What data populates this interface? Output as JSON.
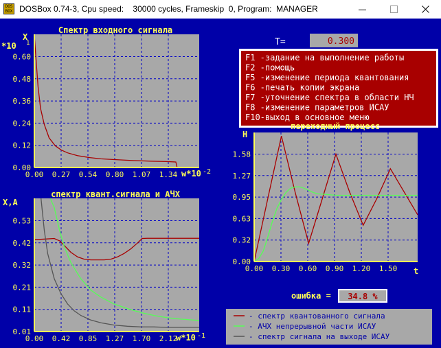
{
  "window": {
    "title": "DOSBox 0.74-3, Cpu speed:    30000 cycles, Frameskip  0, Program:  MANAGER",
    "icon_label": "DOS BOX"
  },
  "colors": {
    "background": "#0000a8",
    "plot_bg": "#a8a8a8",
    "title_yellow": "#ffff55",
    "grid_blue": "#0000c8",
    "series_red": "#a80000",
    "series_green": "#55ff55",
    "series_gray": "#555555",
    "menu_bg": "#a80000"
  },
  "period": {
    "label": "T=",
    "value": "0.300"
  },
  "menu": {
    "items": [
      {
        "key": "F1",
        "text": " -задание на выполнение работы"
      },
      {
        "key": "F2",
        "text": " -помощь"
      },
      {
        "key": "F5",
        "text": " -изменение периода квантования"
      },
      {
        "key": "F6",
        "text": " -печать копии экрана"
      },
      {
        "key": "F7",
        "text": " -уточнение спектра в области НЧ"
      },
      {
        "key": "F8",
        "text": " -изменение параметров ИСАУ"
      },
      {
        "key": "F10",
        "text": "-выход в основное меню"
      }
    ]
  },
  "error": {
    "label": "ошибка =",
    "value": "34.8 %"
  },
  "legend": [
    {
      "text": "- спектр квантованного сигнала",
      "color": "#a80000"
    },
    {
      "text": "- АЧХ непрерывной части ИСАУ",
      "color": "#55ff55"
    },
    {
      "text": "- спектр сигнала на выходе ИСАУ",
      "color": "#555555"
    }
  ],
  "chart_data": [
    {
      "type": "line",
      "title": "Спектр входного сигнала",
      "ylabel": "X",
      "yscale_label": "*10",
      "yscale_exp": "1",
      "xunit_label": "w*10",
      "xunit_exp": "-2",
      "yticks": [
        "0.60",
        "0.48",
        "0.36",
        "0.24",
        "0.12",
        "0.00"
      ],
      "xticks": [
        "0.00",
        "0.27",
        "0.54",
        "0.80",
        "1.07",
        "1.34"
      ],
      "xlim": [
        0,
        1.34
      ],
      "ylim": [
        0,
        0.675
      ],
      "series": [
        {
          "color": "#a80000",
          "x": [
            0.0,
            0.01,
            0.03,
            0.05,
            0.08,
            0.12,
            0.17,
            0.22,
            0.27,
            0.35,
            0.45,
            0.54,
            0.65,
            0.8,
            0.95,
            1.07,
            1.15,
            1.16,
            1.25,
            1.34
          ],
          "y": [
            0.67,
            0.58,
            0.41,
            0.3,
            0.22,
            0.15,
            0.11,
            0.088,
            0.074,
            0.06,
            0.05,
            0.044,
            0.04,
            0.035,
            0.032,
            0.03,
            0.028,
            0.0,
            0.0,
            0.0
          ]
        }
      ]
    },
    {
      "type": "line",
      "title": "спектр квант.сигнала и АЧХ",
      "ylabel": "X,A",
      "xunit_label": "w*10",
      "xunit_exp": "-1",
      "yticks": [
        "0.53",
        "0.42",
        "0.32",
        "0.21",
        "0.11",
        "0.01"
      ],
      "xticks": [
        "0.00",
        "0.42",
        "0.85",
        "1.27",
        "1.70",
        "2.12"
      ],
      "xlim": [
        0,
        2.48
      ],
      "ylim": [
        0.01,
        0.59
      ],
      "series": [
        {
          "color": "#a80000",
          "x": [
            0.0,
            0.3,
            0.38,
            0.45,
            0.55,
            0.65,
            0.75,
            0.85,
            0.95,
            1.05,
            1.15,
            1.25,
            1.35,
            1.45,
            1.55,
            1.62,
            1.7,
            1.8,
            2.0,
            2.2,
            2.48
          ],
          "y": [
            0.41,
            0.415,
            0.405,
            0.385,
            0.355,
            0.335,
            0.325,
            0.322,
            0.322,
            0.322,
            0.325,
            0.335,
            0.35,
            0.37,
            0.395,
            0.415,
            0.416,
            0.416,
            0.416,
            0.416,
            0.416
          ]
        },
        {
          "color": "#55ff55",
          "x": [
            0.24,
            0.3,
            0.38,
            0.45,
            0.55,
            0.7,
            0.85,
            1.0,
            1.2,
            1.4,
            1.6,
            1.8,
            2.0,
            2.2,
            2.48
          ],
          "y": [
            0.59,
            0.55,
            0.45,
            0.38,
            0.31,
            0.24,
            0.19,
            0.16,
            0.13,
            0.11,
            0.093,
            0.08,
            0.07,
            0.064,
            0.058
          ]
        },
        {
          "color": "#555555",
          "x": [
            0.1,
            0.15,
            0.2,
            0.3,
            0.4,
            0.5,
            0.6,
            0.7,
            0.85,
            1.0,
            1.2,
            1.4,
            1.6,
            1.8,
            2.0,
            2.2,
            2.48
          ],
          "y": [
            0.59,
            0.45,
            0.35,
            0.24,
            0.175,
            0.13,
            0.1,
            0.08,
            0.06,
            0.048,
            0.038,
            0.033,
            0.03,
            0.03,
            0.028,
            0.028,
            0.028
          ]
        }
      ]
    },
    {
      "type": "line",
      "title": "переходный процесс",
      "ylabel": "H",
      "xunit_label": "t",
      "yticks": [
        "1.58",
        "1.27",
        "0.95",
        "0.63",
        "0.32",
        "0.00"
      ],
      "xticks": [
        "0.00",
        "0.30",
        "0.60",
        "0.90",
        "1.20",
        "1.50"
      ],
      "xlim": [
        0,
        1.8
      ],
      "ylim": [
        0,
        1.85
      ],
      "series": [
        {
          "color": "#a80000",
          "x": [
            0.0,
            0.15,
            0.3,
            0.45,
            0.6,
            0.75,
            0.9,
            1.05,
            1.2,
            1.35,
            1.5,
            1.65,
            1.8
          ],
          "y": [
            0.0,
            0.9,
            1.8,
            1.0,
            0.26,
            0.9,
            1.54,
            1.0,
            0.52,
            0.9,
            1.33,
            1.0,
            0.67
          ]
        },
        {
          "color": "#55ff55",
          "x": [
            0.0,
            0.05,
            0.1,
            0.15,
            0.2,
            0.25,
            0.3,
            0.35,
            0.4,
            0.45,
            0.5,
            0.55,
            0.6,
            0.65,
            0.7,
            0.8,
            0.9,
            1.0,
            1.2,
            1.4,
            1.6,
            1.8
          ],
          "y": [
            0.0,
            0.04,
            0.15,
            0.35,
            0.57,
            0.76,
            0.89,
            0.99,
            1.05,
            1.07,
            1.07,
            1.05,
            1.02,
            0.99,
            0.97,
            0.96,
            0.95,
            0.95,
            0.95,
            0.95,
            0.95,
            0.95
          ]
        }
      ]
    }
  ]
}
